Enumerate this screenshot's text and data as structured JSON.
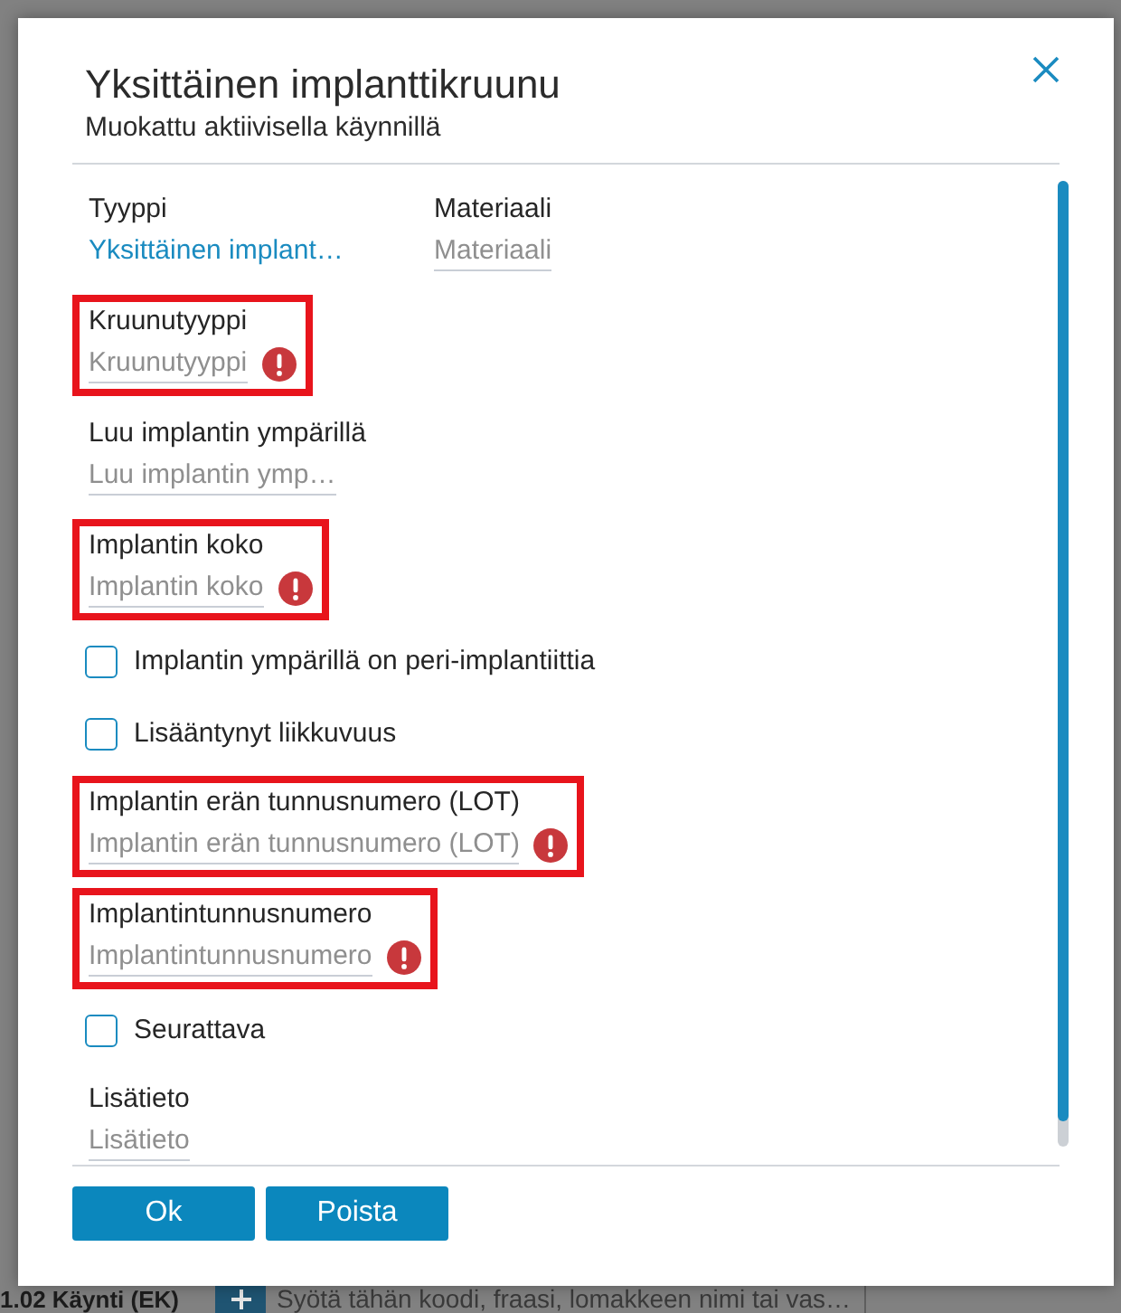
{
  "dialog": {
    "title": "Yksittäinen implanttikruunu",
    "subtitle": "Muokattu aktiivisella käynnillä",
    "fields": [
      {
        "kind": "pair",
        "highlighted": false,
        "items": [
          {
            "label": "Tyyppi",
            "value": "Yksittäinen implant…",
            "error": false
          },
          {
            "label": "Materiaali",
            "placeholder": "Materiaali",
            "error": false
          }
        ]
      },
      {
        "kind": "field",
        "label": "Kruunutyyppi",
        "placeholder": "Kruunutyyppi",
        "error": true,
        "highlighted": true
      },
      {
        "kind": "field",
        "label": "Luu implantin ympärillä",
        "placeholder": "Luu implantin ymp…",
        "error": false,
        "highlighted": false
      },
      {
        "kind": "field",
        "label": "Implantin koko",
        "placeholder": "Implantin koko",
        "error": true,
        "highlighted": true
      },
      {
        "kind": "checkbox",
        "label": "Implantin ympärillä on peri-implantiittia",
        "checked": false,
        "highlighted": false
      },
      {
        "kind": "checkbox",
        "label": "Lisääntynyt liikkuvuus",
        "checked": false,
        "highlighted": false
      },
      {
        "kind": "field",
        "label": "Implantin erän tunnusnumero (LOT)",
        "placeholder": "Implantin erän tunnusnumero (LOT)",
        "error": true,
        "highlighted": true
      },
      {
        "kind": "field",
        "label": "Implantintunnusnumero",
        "placeholder": "Implantintunnusnumero",
        "error": true,
        "highlighted": true
      },
      {
        "kind": "checkbox",
        "label": "Seurattava",
        "checked": false,
        "highlighted": false
      },
      {
        "kind": "field",
        "label": "Lisätieto",
        "placeholder": "Lisätieto",
        "error": false,
        "highlighted": false
      }
    ],
    "buttons": [
      {
        "label": "Ok"
      },
      {
        "label": "Poista"
      }
    ]
  },
  "background": {
    "visit_label": "1.02 Käynti (EK)",
    "entry_field": {
      "placeholder": "Syötä tähän koodi, fraasi, lomakkeen nimi tai vas…"
    }
  }
}
